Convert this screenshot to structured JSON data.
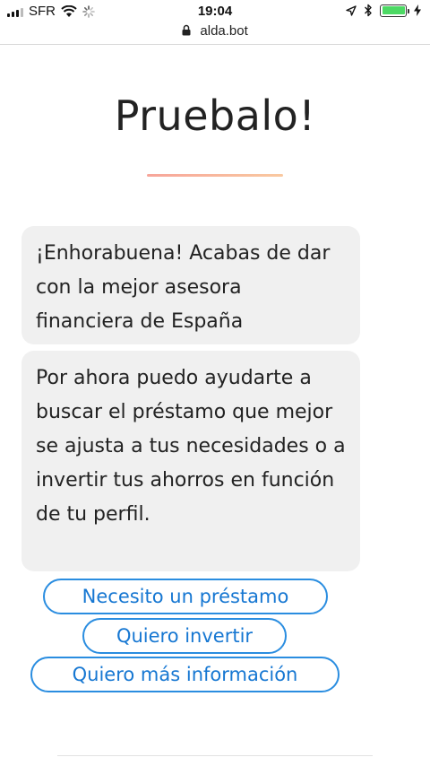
{
  "status_bar": {
    "carrier": "SFR",
    "time": "19:04",
    "icons": [
      "signal-icon",
      "wifi-icon",
      "loading-icon",
      "location-icon",
      "bluetooth-icon",
      "battery-icon",
      "charging-icon"
    ],
    "battery_level": 1.0,
    "battery_color": "#4cd964"
  },
  "browser": {
    "url": "alda.bot",
    "icon": "lock-icon"
  },
  "main": {
    "title": "Pruebalo!",
    "underline_colors": [
      "#f7a59a",
      "#f9c9a0"
    ]
  },
  "chat": {
    "messages": [
      {
        "text": "¡Enhorabuena! Acabas de dar con la mejor asesora financiera de España"
      },
      {
        "text": "Por ahora puedo ayudarte a buscar el préstamo que mejor se ajusta a tus necesidades o a invertir tus ahorros en función de tu perfil."
      }
    ],
    "bubble_color": "#f0f0f0"
  },
  "options": [
    {
      "label": "Necesito un préstamo"
    },
    {
      "label": "Quiero invertir"
    },
    {
      "label": "Quiero más información"
    }
  ],
  "accent_color": "#2a8de0"
}
